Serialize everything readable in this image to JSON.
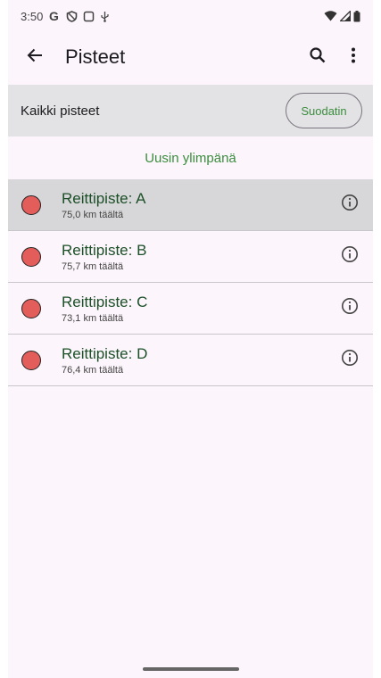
{
  "status_bar": {
    "time": "3:50",
    "icons": [
      "google-g-icon",
      "shield-icon",
      "screen-icon",
      "usb-icon",
      "wifi-icon",
      "signal-icon",
      "battery-icon"
    ]
  },
  "app_bar": {
    "title": "Pisteet",
    "icons": [
      "back-arrow-icon",
      "search-icon",
      "more-vert-icon"
    ]
  },
  "filter": {
    "label": "Kaikki pisteet",
    "button_label": "Suodatin"
  },
  "sort": {
    "label": "Uusin ylimpänä"
  },
  "waypoints": [
    {
      "title": "Reittipiste: A",
      "distance": "75,0 km täältä",
      "selected": true
    },
    {
      "title": "Reittipiste: B",
      "distance": "75,7 km täältä",
      "selected": false
    },
    {
      "title": "Reittipiste: C",
      "distance": "73,1 km täältä",
      "selected": false
    },
    {
      "title": "Reittipiste: D",
      "distance": "76,4 km täältä",
      "selected": false
    }
  ],
  "colors": {
    "accent_green": "#3a8d3e",
    "item_title": "#1b4f27",
    "dot_red": "#e35d5b",
    "background": "#fcf5fb",
    "filter_bar": "#e3e2e4",
    "selected_row": "#d7d6d8"
  }
}
